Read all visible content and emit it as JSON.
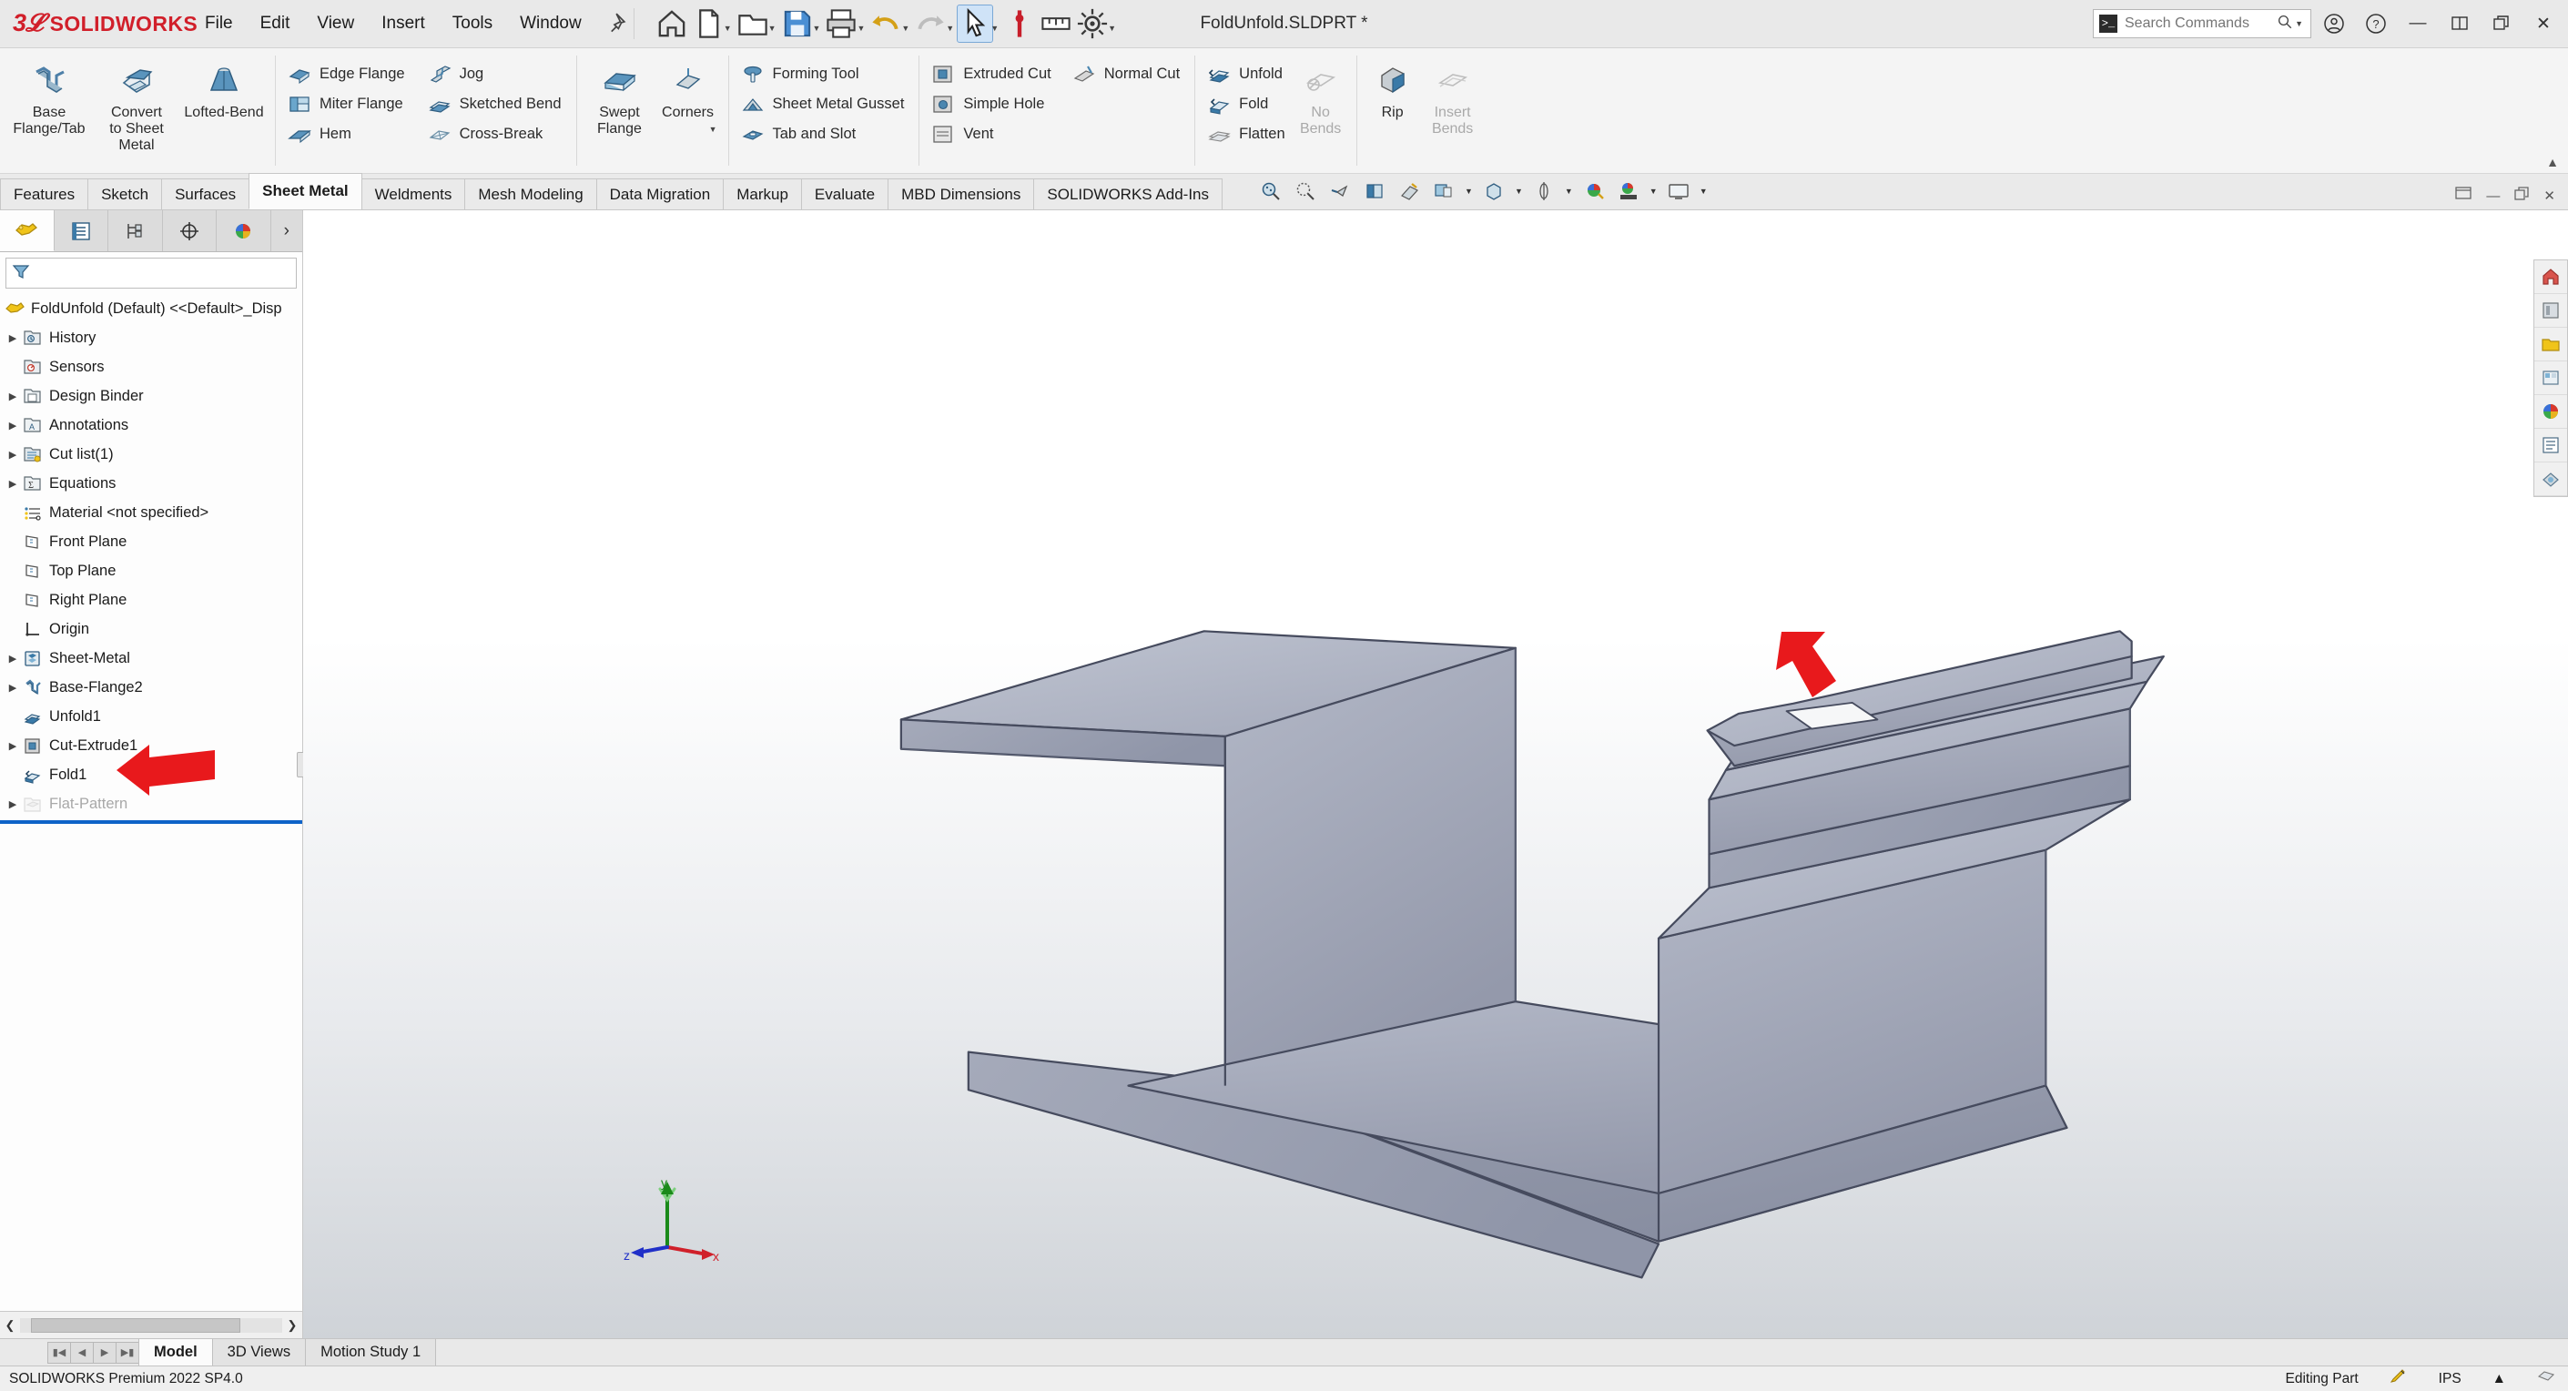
{
  "app": {
    "brand_short": "3S",
    "brand_name": "SOLIDWORKS",
    "document_title": "FoldUnfold.SLDPRT *",
    "version_status": "SOLIDWORKS Premium 2022 SP4.0"
  },
  "menu": {
    "items": [
      "File",
      "Edit",
      "View",
      "Insert",
      "Tools",
      "Window"
    ]
  },
  "search": {
    "placeholder": "Search Commands",
    "value": ""
  },
  "titlebar_icons": [
    "home-icon",
    "new-document-icon",
    "open-folder-icon",
    "save-icon",
    "print-icon",
    "undo-icon",
    "redo-icon",
    "select-arrow-icon",
    "rebuild-icon",
    "options-gear-icon"
  ],
  "window_controls": {
    "account": "account-icon",
    "help": "help-icon",
    "minimize": "minimize-icon",
    "restore": "restore-icon",
    "maximize": "maximize-icon",
    "close": "close-icon"
  },
  "ribbon": {
    "groups": [
      {
        "name": "base",
        "big_buttons": [
          {
            "label": "Base\nFlange/Tab",
            "icon": "base-flange-icon",
            "dim": false
          },
          {
            "label": "Convert\nto Sheet\nMetal",
            "icon": "convert-sheet-metal-icon",
            "dim": false
          },
          {
            "label": "Lofted-Bend",
            "icon": "lofted-bend-icon",
            "dim": false
          }
        ]
      },
      {
        "name": "flange-column-1",
        "small_buttons": [
          {
            "label": "Edge Flange",
            "icon": "edge-flange-icon",
            "dim": false
          },
          {
            "label": "Miter Flange",
            "icon": "miter-flange-icon",
            "dim": false
          },
          {
            "label": "Hem",
            "icon": "hem-icon",
            "dim": false
          }
        ]
      },
      {
        "name": "flange-column-2",
        "small_buttons": [
          {
            "label": "Jog",
            "icon": "jog-icon",
            "dim": false
          },
          {
            "label": "Sketched Bend",
            "icon": "sketched-bend-icon",
            "dim": false
          },
          {
            "label": "Cross-Break",
            "icon": "cross-break-icon",
            "dim": false
          }
        ]
      },
      {
        "name": "swept",
        "big_buttons": [
          {
            "label": "Swept\nFlange",
            "icon": "swept-flange-icon",
            "dim": false
          },
          {
            "label": "Corners",
            "icon": "corners-icon",
            "dim": false
          }
        ]
      },
      {
        "name": "forming",
        "small_buttons": [
          {
            "label": "Forming Tool",
            "icon": "forming-tool-icon",
            "dim": false
          },
          {
            "label": "Sheet Metal Gusset",
            "icon": "sheet-metal-gusset-icon",
            "dim": false
          },
          {
            "label": "Tab and Slot",
            "icon": "tab-and-slot-icon",
            "dim": false
          }
        ]
      },
      {
        "name": "cut-column-1",
        "small_buttons": [
          {
            "label": "Extruded Cut",
            "icon": "extruded-cut-icon",
            "dim": false
          },
          {
            "label": "Simple Hole",
            "icon": "simple-hole-icon",
            "dim": false
          },
          {
            "label": "Vent",
            "icon": "vent-icon",
            "dim": false
          }
        ]
      },
      {
        "name": "cut-column-2",
        "small_buttons": [
          {
            "label": "Normal Cut",
            "icon": "normal-cut-icon",
            "dim": false
          }
        ]
      },
      {
        "name": "fold-unfold",
        "small_buttons": [
          {
            "label": "Unfold",
            "icon": "unfold-icon",
            "dim": false
          },
          {
            "label": "Fold",
            "icon": "fold-icon",
            "dim": false
          },
          {
            "label": "Flatten",
            "icon": "flatten-icon",
            "dim": false
          }
        ],
        "big_buttons": [
          {
            "label": "No\nBends",
            "icon": "no-bends-icon",
            "dim": true
          }
        ]
      },
      {
        "name": "rip",
        "big_buttons": [
          {
            "label": "Rip",
            "icon": "rip-icon",
            "dim": false
          },
          {
            "label": "Insert\nBends",
            "icon": "insert-bends-icon",
            "dim": true
          }
        ]
      }
    ]
  },
  "command_tabs": {
    "items": [
      "Features",
      "Sketch",
      "Surfaces",
      "Sheet Metal",
      "Weldments",
      "Mesh Modeling",
      "Data Migration",
      "Markup",
      "Evaluate",
      "MBD Dimensions",
      "SOLIDWORKS Add-Ins"
    ],
    "active": "Sheet Metal"
  },
  "feature_manager": {
    "tabs": [
      "featuremanager-design-tree-tab",
      "property-manager-tab",
      "configuration-manager-tab",
      "dimxpert-manager-tab",
      "display-manager-tab"
    ],
    "active_tab_index": 0,
    "more_tabs_icon": "chevron-right-icon",
    "filter_icon": "filter-icon",
    "filter_value": "",
    "root": "FoldUnfold (Default) <<Default>_Disp",
    "root_icon": "part-icon",
    "tree": [
      {
        "label": "History",
        "icon": "history-icon",
        "expandable": true,
        "indent": 0,
        "dim": false
      },
      {
        "label": "Sensors",
        "icon": "sensors-icon",
        "expandable": false,
        "indent": 0,
        "dim": false
      },
      {
        "label": "Design Binder",
        "icon": "design-binder-icon",
        "expandable": true,
        "indent": 0,
        "dim": false
      },
      {
        "label": "Annotations",
        "icon": "annotations-icon",
        "expandable": true,
        "indent": 0,
        "dim": false
      },
      {
        "label": "Cut list(1)",
        "icon": "cut-list-icon",
        "expandable": true,
        "indent": 0,
        "dim": false
      },
      {
        "label": "Equations",
        "icon": "equations-icon",
        "expandable": true,
        "indent": 0,
        "dim": false
      },
      {
        "label": "Material <not specified>",
        "icon": "material-icon",
        "expandable": false,
        "indent": 0,
        "dim": false
      },
      {
        "label": "Front Plane",
        "icon": "plane-icon",
        "expandable": false,
        "indent": 0,
        "dim": false
      },
      {
        "label": "Top Plane",
        "icon": "plane-icon",
        "expandable": false,
        "indent": 0,
        "dim": false
      },
      {
        "label": "Right Plane",
        "icon": "plane-icon",
        "expandable": false,
        "indent": 0,
        "dim": false
      },
      {
        "label": "Origin",
        "icon": "origin-icon",
        "expandable": false,
        "indent": 0,
        "dim": false
      },
      {
        "label": "Sheet-Metal",
        "icon": "sheet-metal-feature-icon",
        "expandable": true,
        "indent": 0,
        "dim": false
      },
      {
        "label": "Base-Flange2",
        "icon": "base-flange-feature-icon",
        "expandable": true,
        "indent": 0,
        "dim": false
      },
      {
        "label": "Unfold1",
        "icon": "unfold-feature-icon",
        "expandable": false,
        "indent": 0,
        "dim": false
      },
      {
        "label": "Cut-Extrude1",
        "icon": "cut-extrude-feature-icon",
        "expandable": true,
        "indent": 0,
        "dim": false
      },
      {
        "label": "Fold1",
        "icon": "fold-feature-icon",
        "expandable": false,
        "indent": 0,
        "dim": false
      },
      {
        "label": "Flat-Pattern",
        "icon": "flat-pattern-icon",
        "expandable": true,
        "indent": 0,
        "dim": true
      }
    ]
  },
  "heads_up_toolbar": {
    "buttons": [
      "zoom-to-fit-icon",
      "zoom-to-area-icon",
      "previous-view-icon",
      "section-view-icon",
      "view-orientation-icon",
      "display-style-icon",
      "hide-show-items-icon",
      "edit-appearance-icon",
      "apply-scene-icon",
      "view-settings-icon"
    ]
  },
  "right_dock": {
    "items": [
      "view-palette-home-icon",
      "design-library-icon",
      "file-explorer-icon",
      "search-library-icon",
      "view-palette-icon",
      "appearances-icon",
      "custom-properties-icon",
      "render-tools-icon"
    ]
  },
  "graphics": {
    "triad": {
      "x_label": "x",
      "y_label": "y",
      "z_label": "z"
    },
    "annotation_arrows": [
      {
        "name": "model-arrow",
        "points_to": "fold-region-on-model"
      },
      {
        "name": "tree-arrow",
        "points_to": "Fold1"
      }
    ],
    "model_colors": {
      "face_light": "#a8adbd",
      "face_mid": "#9096a8",
      "face_dark": "#7f869a",
      "edge": "#41465a"
    }
  },
  "bottom_tabs": {
    "items": [
      "Model",
      "3D Views",
      "Motion Study 1"
    ],
    "active": "Model",
    "nav_buttons": [
      "first-icon",
      "previous-icon",
      "next-icon",
      "last-icon"
    ]
  },
  "status_bar": {
    "left": "SOLIDWORKS Premium 2022 SP4.0",
    "editing_state": "Editing Part",
    "editing_icon": "edit-part-icon",
    "units": "IPS",
    "units_caret": "caret-up-icon",
    "overlay_icon": "overlay-icon"
  }
}
